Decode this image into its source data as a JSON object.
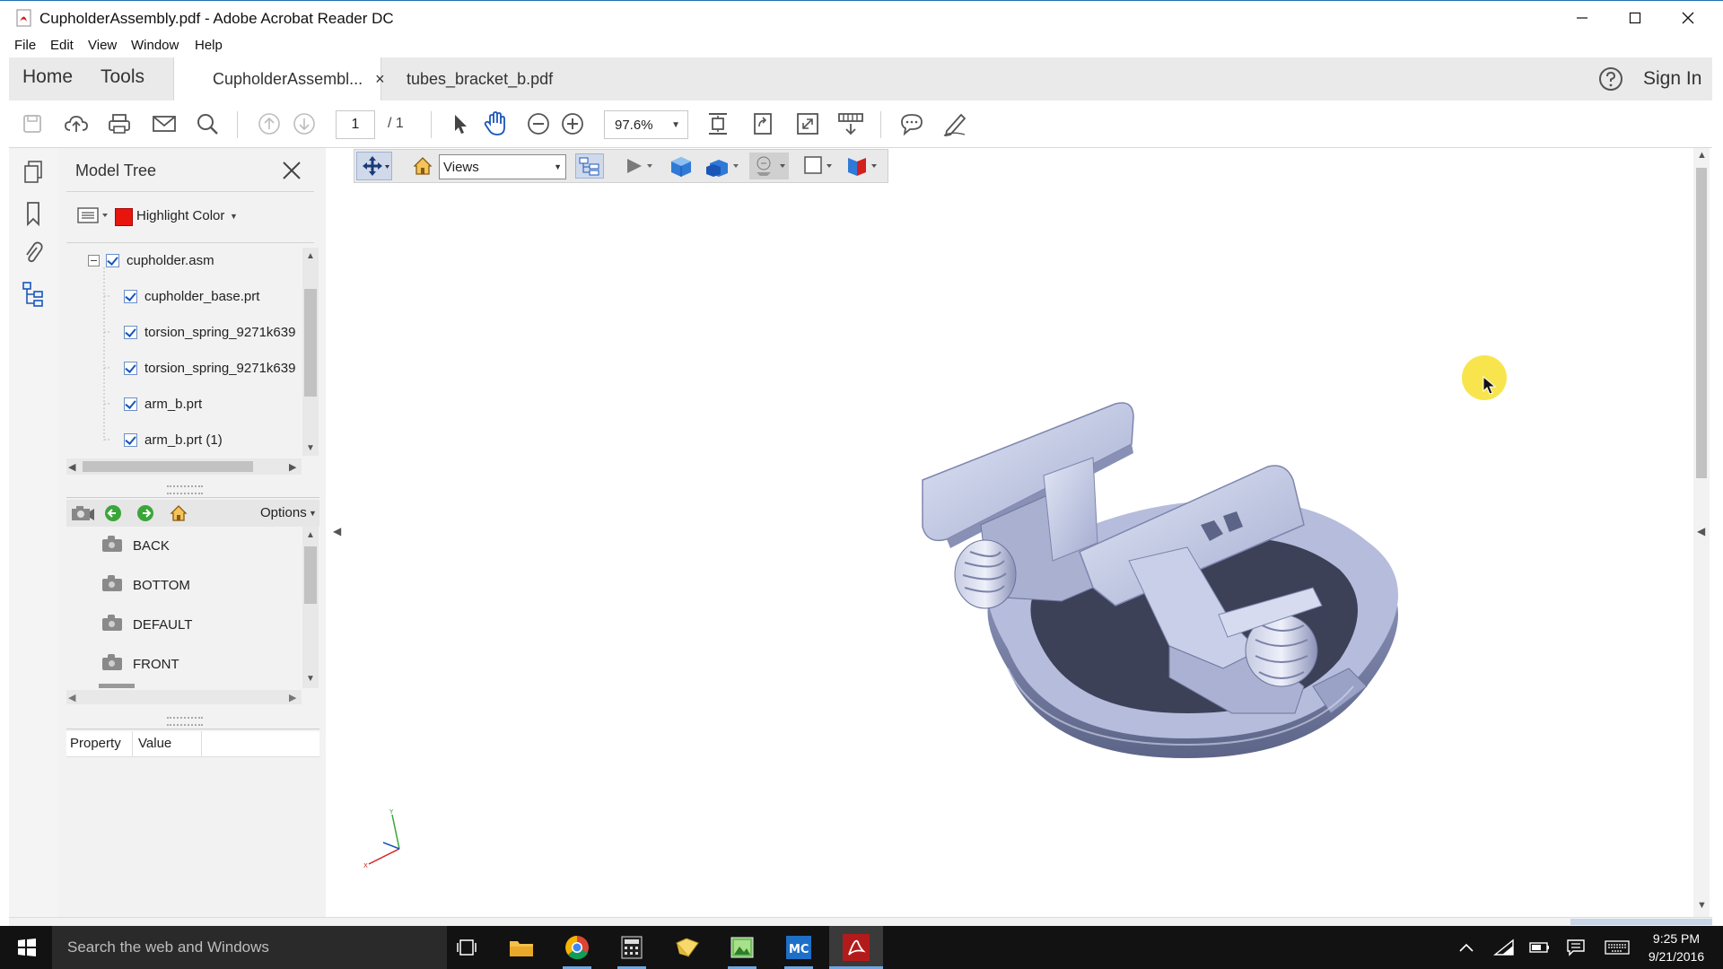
{
  "window": {
    "title": "CupholderAssembly.pdf - Adobe Acrobat Reader DC"
  },
  "menu": {
    "items": [
      "File",
      "Edit",
      "View",
      "Window",
      "Help"
    ]
  },
  "tabs": {
    "home": "Home",
    "tools": "Tools",
    "documents": [
      {
        "label": "CupholderAssembl...",
        "close": "×"
      },
      {
        "label": "tubes_bracket_b.pdf"
      }
    ],
    "sign_in": "Sign In",
    "help_icon": "question-circle-icon"
  },
  "toolbar": {
    "page_current": "1",
    "page_total": "/ 1",
    "zoom": "97.6%"
  },
  "model_tree": {
    "title": "Model Tree",
    "highlight_label": "Highlight Color",
    "highlight_color": "#e8150c",
    "items": [
      {
        "label": "cupholder.asm"
      },
      {
        "label": "cupholder_base.prt"
      },
      {
        "label": "torsion_spring_9271k639"
      },
      {
        "label": "torsion_spring_9271k639"
      },
      {
        "label": "arm_b.prt"
      },
      {
        "label": "arm_b.prt (1)"
      }
    ],
    "options_label": "Options",
    "views": [
      "BACK",
      "BOTTOM",
      "DEFAULT",
      "FRONT"
    ],
    "property_header": "Property",
    "value_header": "Value"
  },
  "toolbar_3d": {
    "views_label": "Views"
  },
  "taskbar": {
    "search_placeholder": "Search the web and Windows",
    "time": "9:25 PM",
    "date": "9/21/2016"
  },
  "colors": {
    "accent": "#1a56b8",
    "adobe_red": "#d4201c",
    "cursor_highlight": "#f7e23a"
  }
}
